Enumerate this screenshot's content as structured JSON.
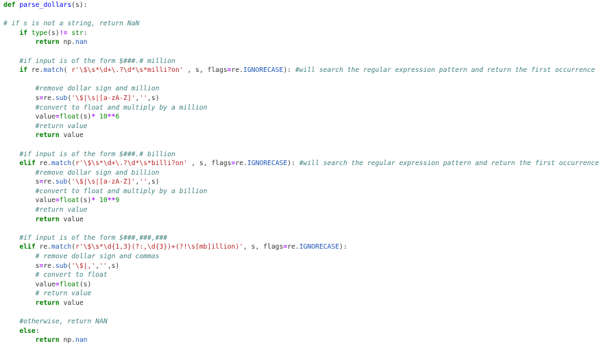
{
  "editor": {
    "lines": [
      [
        {
          "t": "def",
          "c": "kw"
        },
        {
          "t": " "
        },
        {
          "t": "parse_dollars",
          "c": "fn"
        },
        {
          "t": "(s):"
        }
      ],
      [],
      [
        {
          "t": "# if s is not a string, return NaN",
          "c": "cm"
        }
      ],
      [
        {
          "t": "    "
        },
        {
          "t": "if",
          "c": "kw"
        },
        {
          "t": " "
        },
        {
          "t": "type",
          "c": "nb"
        },
        {
          "t": "(s)"
        },
        {
          "t": "!=",
          "c": "op"
        },
        {
          "t": " "
        },
        {
          "t": "str",
          "c": "nb"
        },
        {
          "t": ":"
        }
      ],
      [
        {
          "t": "        "
        },
        {
          "t": "return",
          "c": "kw"
        },
        {
          "t": " np."
        },
        {
          "t": "nan",
          "c": "at"
        }
      ],
      [],
      [
        {
          "t": "    "
        },
        {
          "t": "#if input is of the form $###.# million",
          "c": "cm"
        }
      ],
      [
        {
          "t": "    "
        },
        {
          "t": "if",
          "c": "kw"
        },
        {
          "t": " re."
        },
        {
          "t": "match",
          "c": "at"
        },
        {
          "t": "( "
        },
        {
          "t": "r'\\$\\s*\\d+\\.?\\d*\\s*milli?on'",
          "c": "st"
        },
        {
          "t": " , s, flags"
        },
        {
          "t": "=",
          "c": "op"
        },
        {
          "t": "re."
        },
        {
          "t": "IGNORECASE",
          "c": "at"
        },
        {
          "t": "): "
        },
        {
          "t": "#will search the regular expression pattern and return the first occurrence",
          "c": "cm"
        }
      ],
      [],
      [
        {
          "t": "        "
        },
        {
          "t": "#remove dollar sign and million",
          "c": "cm"
        }
      ],
      [
        {
          "t": "        s"
        },
        {
          "t": "=",
          "c": "op"
        },
        {
          "t": "re."
        },
        {
          "t": "sub",
          "c": "at"
        },
        {
          "t": "("
        },
        {
          "t": "'\\$|\\s|[a-zA-Z]'",
          "c": "st"
        },
        {
          "t": ","
        },
        {
          "t": "''",
          "c": "st"
        },
        {
          "t": ",s)"
        }
      ],
      [
        {
          "t": "        "
        },
        {
          "t": "#convert to float and multiply by a million",
          "c": "cm"
        }
      ],
      [
        {
          "t": "        value"
        },
        {
          "t": "=",
          "c": "op"
        },
        {
          "t": "float",
          "c": "nb"
        },
        {
          "t": "(s)"
        },
        {
          "t": "*",
          "c": "op"
        },
        {
          "t": " "
        },
        {
          "t": "10",
          "c": "nm"
        },
        {
          "t": "**",
          "c": "op"
        },
        {
          "t": "6",
          "c": "nm"
        }
      ],
      [
        {
          "t": "        "
        },
        {
          "t": "#return value",
          "c": "cm"
        }
      ],
      [
        {
          "t": "        "
        },
        {
          "t": "return",
          "c": "kw"
        },
        {
          "t": " value"
        }
      ],
      [],
      [
        {
          "t": "    "
        },
        {
          "t": "#if input is of the form $###.# billion",
          "c": "cm"
        }
      ],
      [
        {
          "t": "    "
        },
        {
          "t": "elif",
          "c": "kw"
        },
        {
          "t": " re."
        },
        {
          "t": "match",
          "c": "at"
        },
        {
          "t": "("
        },
        {
          "t": "r'\\$\\s*\\d+\\.?\\d*\\s*billi?on'",
          "c": "st"
        },
        {
          "t": " , s, flags"
        },
        {
          "t": "=",
          "c": "op"
        },
        {
          "t": "re."
        },
        {
          "t": "IGNORECASE",
          "c": "at"
        },
        {
          "t": "): "
        },
        {
          "t": "#will search the regular expression pattern and return the first occurrence",
          "c": "cm"
        }
      ],
      [
        {
          "t": "        "
        },
        {
          "t": "#remove dollar sign and billion",
          "c": "cm"
        }
      ],
      [
        {
          "t": "        s"
        },
        {
          "t": "=",
          "c": "op"
        },
        {
          "t": "re."
        },
        {
          "t": "sub",
          "c": "at"
        },
        {
          "t": "("
        },
        {
          "t": "'\\$|\\s|[a-zA-Z]'",
          "c": "st"
        },
        {
          "t": ","
        },
        {
          "t": "''",
          "c": "st"
        },
        {
          "t": ",s)"
        }
      ],
      [
        {
          "t": "        "
        },
        {
          "t": "#convert to float and multiply by a billion",
          "c": "cm"
        }
      ],
      [
        {
          "t": "        value"
        },
        {
          "t": "=",
          "c": "op"
        },
        {
          "t": "float",
          "c": "nb"
        },
        {
          "t": "(s)"
        },
        {
          "t": "*",
          "c": "op"
        },
        {
          "t": " "
        },
        {
          "t": "10",
          "c": "nm"
        },
        {
          "t": "**",
          "c": "op"
        },
        {
          "t": "9",
          "c": "nm"
        }
      ],
      [
        {
          "t": "        "
        },
        {
          "t": "#return value",
          "c": "cm"
        }
      ],
      [
        {
          "t": "        "
        },
        {
          "t": "return",
          "c": "kw"
        },
        {
          "t": " value"
        }
      ],
      [],
      [
        {
          "t": "    "
        },
        {
          "t": "#if input is of the form $###,###,###",
          "c": "cm"
        }
      ],
      [
        {
          "t": "    "
        },
        {
          "t": "elif",
          "c": "kw"
        },
        {
          "t": " re."
        },
        {
          "t": "match",
          "c": "at"
        },
        {
          "t": "("
        },
        {
          "t": "r'\\$\\s*\\d{1,3}(?:,\\d{3})+(?!\\s[mb]illion)'",
          "c": "st"
        },
        {
          "t": ", s, flags"
        },
        {
          "t": "=",
          "c": "op"
        },
        {
          "t": "re."
        },
        {
          "t": "IGNORECASE",
          "c": "at"
        },
        {
          "t": "):"
        }
      ],
      [
        {
          "t": "        "
        },
        {
          "t": "# remove dollar sign and commas",
          "c": "cm"
        }
      ],
      [
        {
          "t": "        s"
        },
        {
          "t": "=",
          "c": "op"
        },
        {
          "t": "re."
        },
        {
          "t": "sub",
          "c": "at"
        },
        {
          "t": "("
        },
        {
          "t": "'\\$|,'",
          "c": "st"
        },
        {
          "t": ","
        },
        {
          "t": "''",
          "c": "st"
        },
        {
          "t": ",s)"
        }
      ],
      [
        {
          "t": "        "
        },
        {
          "t": "# convert to float",
          "c": "cm"
        }
      ],
      [
        {
          "t": "        value"
        },
        {
          "t": "=",
          "c": "op"
        },
        {
          "t": "float",
          "c": "nb"
        },
        {
          "t": "(s)"
        }
      ],
      [
        {
          "t": "        "
        },
        {
          "t": "# return value",
          "c": "cm"
        }
      ],
      [
        {
          "t": "        "
        },
        {
          "t": "return",
          "c": "kw"
        },
        {
          "t": " value"
        }
      ],
      [],
      [
        {
          "t": "    "
        },
        {
          "t": "#otherwise, return NAN",
          "c": "cm"
        }
      ],
      [
        {
          "t": "    "
        },
        {
          "t": "else",
          "c": "kw"
        },
        {
          "t": ":"
        }
      ],
      [
        {
          "t": "        "
        },
        {
          "t": "return",
          "c": "kw"
        },
        {
          "t": " np."
        },
        {
          "t": "nan",
          "c": "at"
        }
      ]
    ]
  }
}
